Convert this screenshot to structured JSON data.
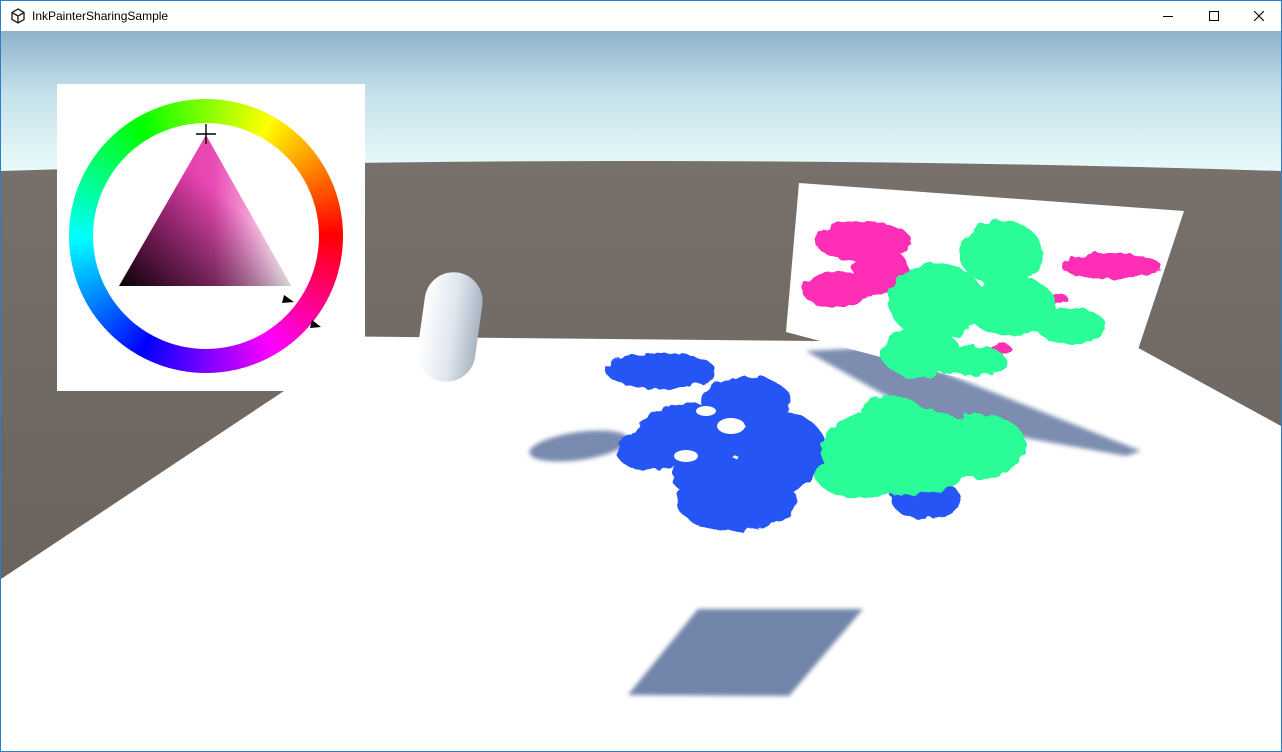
{
  "window": {
    "title": "InkPainterSharingSample",
    "icon": "unity-logo-icon",
    "controls": [
      "minimize-icon",
      "maximize-icon",
      "close-icon"
    ]
  },
  "colors": {
    "selected_ink": "#e52aa6",
    "blue_ink": "#2755f5",
    "green_ink": "#2bfd98",
    "pink_ink": "#ff2fb6",
    "shadow": "#6a7ea6",
    "ground": "#6b645f",
    "sky_horizon": "#e6f7f8",
    "sky_top": "#8fb3cc"
  }
}
